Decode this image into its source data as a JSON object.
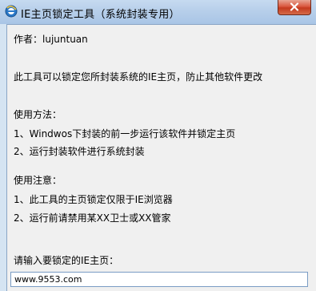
{
  "window": {
    "title": "IE主页锁定工具（系统封装专用）"
  },
  "content": {
    "author": "作者：lujuntuan",
    "description": "此工具可以锁定您所封装系统的IE主页，防止其他软件更改",
    "usage_heading": "使用方法：",
    "usage_steps": [
      "1、Windwos下封装的前一步运行该软件并锁定主页",
      "2、运行封装软件进行系统封装"
    ],
    "notes_heading": "使用注意：",
    "notes": [
      "1、此工具的主页锁定仅限于IE浏览器",
      "2、运行前请禁用某XX卫士或XX管家"
    ],
    "input_label": "请输入要锁定的IE主页：",
    "homepage_value": "www.9553.com"
  },
  "icons": {
    "app": "ie-globe-icon",
    "close": "close-icon"
  },
  "colors": {
    "titlebar": "#b7cfea",
    "close_button": "#d9583f",
    "client_background": "#f0f0f0"
  }
}
